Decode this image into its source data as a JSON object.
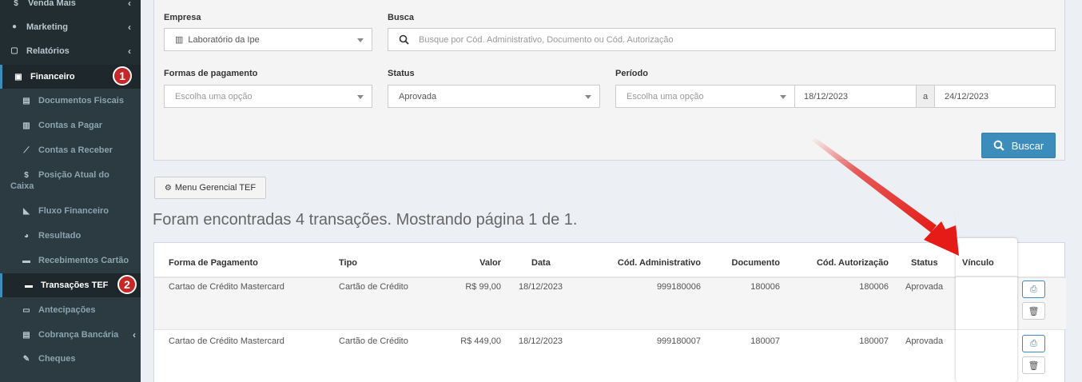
{
  "sidebar": {
    "venda_mais": "Venda Mais",
    "marketing": "Marketing",
    "relatorios": "Relatórios",
    "financeiro": "Financeiro",
    "items": [
      {
        "label": "Documentos Fiscais"
      },
      {
        "label": "Contas a Pagar"
      },
      {
        "label": "Contas a Receber"
      },
      {
        "label": "Posição Atual do"
      },
      {
        "label": "Caixa"
      },
      {
        "label": "Fluxo Financeiro"
      },
      {
        "label": "Resultado"
      },
      {
        "label": "Recebimentos Cartão"
      },
      {
        "label": "Transações TEF"
      },
      {
        "label": "Antecipações"
      },
      {
        "label": "Cobrança Bancária"
      },
      {
        "label": "Cheques"
      }
    ],
    "badge1": "1",
    "badge2": "2"
  },
  "filters": {
    "empresa_label": "Empresa",
    "empresa_value": "Laboratório da Ipe",
    "busca_label": "Busca",
    "busca_placeholder": "Busque por Cód. Administrativo, Documento ou Cód. Autorização",
    "formas_label": "Formas de pagamento",
    "formas_placeholder": "Escolha uma opção",
    "status_label": "Status",
    "status_value": "Aprovada",
    "periodo_label": "Período",
    "periodo_placeholder": "Escolha uma opção",
    "date_from": "18/12/2023",
    "date_sep": "a",
    "date_to": "24/12/2023",
    "buscar_button": "Buscar"
  },
  "menu_tef_button": "Menu Gerencial TEF",
  "result_summary": "Foram encontradas 4 transações. Mostrando página 1 de 1.",
  "table": {
    "headers": {
      "forma": "Forma de Pagamento",
      "tipo": "Tipo",
      "valor": "Valor",
      "data": "Data",
      "cod_adm": "Cód. Administrativo",
      "documento": "Documento",
      "cod_aut": "Cód. Autorização",
      "status": "Status",
      "vinculo": "Vínculo"
    },
    "rows": [
      {
        "forma": "Cartao de Crédito Mastercard",
        "tipo": "Cartão de Crédito",
        "valor": "R$ 99,00",
        "data": "18/12/2023",
        "cod_adm": "999180006",
        "documento": "180006",
        "cod_aut": "180006",
        "status": "Aprovada"
      },
      {
        "forma": "Cartao de Crédito Mastercard",
        "tipo": "Cartão de Crédito",
        "valor": "R$ 449,00",
        "data": "18/12/2023",
        "cod_adm": "999180007",
        "documento": "180007",
        "cod_aut": "180007",
        "status": "Aprovada"
      }
    ]
  },
  "colors": {
    "accent": "#3c8dbc",
    "sidebar": "#222d32",
    "badge": "#c62828",
    "arrow": "#e41b17"
  }
}
